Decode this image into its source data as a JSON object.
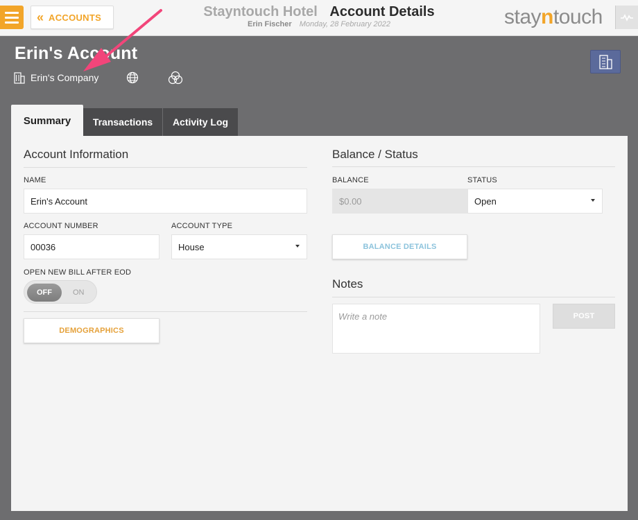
{
  "header": {
    "back_label": "ACCOUNTS",
    "hotel_name": "Stayntouch Hotel",
    "page_title": "Account Details",
    "user_name": "Erin Fischer",
    "business_date": "Monday, 28 February 2022",
    "logo_pre": "stay",
    "logo_n": "n",
    "logo_post": "touch"
  },
  "account": {
    "title": "Erin's Account",
    "company": "Erin's Company"
  },
  "tabs": [
    {
      "label": "Summary",
      "active": true
    },
    {
      "label": "Transactions",
      "active": false
    },
    {
      "label": "Activity Log",
      "active": false
    }
  ],
  "account_info": {
    "section_title": "Account Information",
    "name_label": "NAME",
    "name_value": "Erin's Account",
    "number_label": "ACCOUNT NUMBER",
    "number_value": "00036",
    "type_label": "ACCOUNT TYPE",
    "type_value": "House",
    "bill_label": "OPEN NEW BILL AFTER EOD",
    "toggle_off": "OFF",
    "toggle_on": "ON",
    "toggle_state": "OFF",
    "demographics_label": "DEMOGRAPHICS"
  },
  "balance_status": {
    "section_title": "Balance / Status",
    "balance_label": "BALANCE",
    "balance_value": "$0.00",
    "status_label": "STATUS",
    "status_value": "Open",
    "details_label": "BALANCE DETAILS"
  },
  "notes": {
    "section_title": "Notes",
    "placeholder": "Write a note",
    "post_label": "POST"
  },
  "colors": {
    "accent": "#f2a529",
    "annotation_arrow": "#f2457a",
    "company_button": "#5b6a9b"
  },
  "icons": {
    "menu": "hamburger-icon",
    "back": "double-chevron-left-icon",
    "pulse": "pulse-icon",
    "building": "building-icon",
    "globe": "globe-icon",
    "circles": "overlapping-circles-icon"
  }
}
